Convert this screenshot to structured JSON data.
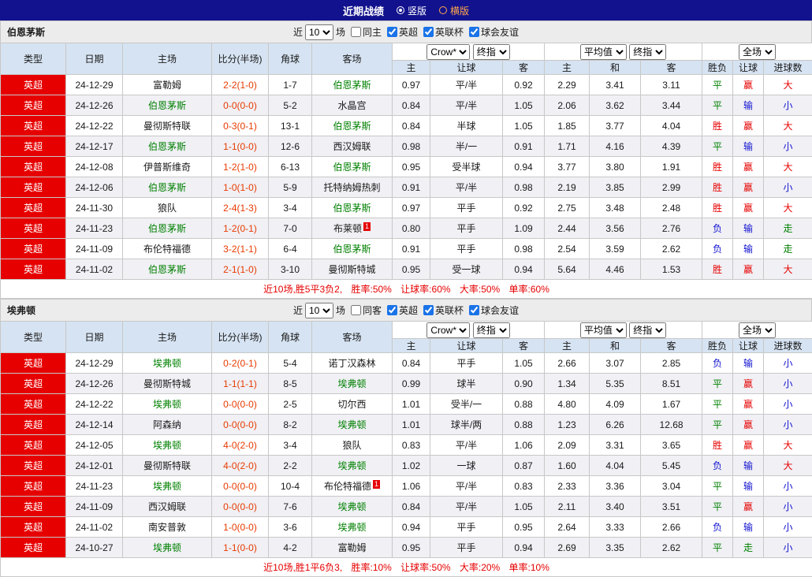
{
  "topbar": {
    "title": "近期战绩",
    "modes": [
      {
        "label": "竖版",
        "selected": true
      },
      {
        "label": "横版",
        "selected": false
      }
    ]
  },
  "columns": {
    "type": "类型",
    "date": "日期",
    "home": "主场",
    "score": "比分(半场)",
    "corner": "角球",
    "away": "客场",
    "bookmaker": "Crow*",
    "stage1": "终指",
    "average": "平均值",
    "stage2": "终指",
    "scope": "全场",
    "sub": [
      "主",
      "让球",
      "客",
      "主",
      "和",
      "客",
      "胜负",
      "让球",
      "进球数"
    ]
  },
  "colors": {
    "topbar_bg": "#12128e",
    "league_badge_bg": "#e60000",
    "focus_team": "#008000",
    "score_text": "#e83a00",
    "summary_text": "#e60000",
    "header_bg": "#d6e3f2",
    "alt_row_bg": "#f0f0f5",
    "mode_inactive": "#ffa64d",
    "result_text": {
      "胜": "#e60000",
      "赢": "#e60000",
      "大": "#e60000",
      "平": "#008000",
      "走": "#008000",
      "负": "#1212d0",
      "输": "#1212d0",
      "小": "#1212d0"
    }
  },
  "tables": [
    {
      "team": "伯恩茅斯",
      "filter": {
        "prefix": "近",
        "count": "10",
        "suffix": "场",
        "same": {
          "label": "同主",
          "checked": false
        },
        "leagues": [
          {
            "label": "英超",
            "checked": true
          },
          {
            "label": "英联杯",
            "checked": true
          },
          {
            "label": "球会友谊",
            "checked": true
          }
        ]
      },
      "rows": [
        {
          "type": "英超",
          "date": "24-12-29",
          "home": "富勒姆",
          "hf": false,
          "score": "2-2(1-0)",
          "corner": "1-7",
          "away": "伯恩茅斯",
          "af": true,
          "badge": "",
          "o": [
            "0.97",
            "平/半",
            "0.92"
          ],
          "avg": [
            "2.29",
            "3.41",
            "3.11"
          ],
          "res": [
            "平",
            "赢",
            "大"
          ]
        },
        {
          "type": "英超",
          "date": "24-12-26",
          "home": "伯恩茅斯",
          "hf": true,
          "score": "0-0(0-0)",
          "corner": "5-2",
          "away": "水晶宫",
          "af": false,
          "badge": "",
          "o": [
            "0.84",
            "平/半",
            "1.05"
          ],
          "avg": [
            "2.06",
            "3.62",
            "3.44"
          ],
          "res": [
            "平",
            "输",
            "小"
          ]
        },
        {
          "type": "英超",
          "date": "24-12-22",
          "home": "曼彻斯特联",
          "hf": false,
          "score": "0-3(0-1)",
          "corner": "13-1",
          "away": "伯恩茅斯",
          "af": true,
          "badge": "",
          "o": [
            "0.84",
            "半球",
            "1.05"
          ],
          "avg": [
            "1.85",
            "3.77",
            "4.04"
          ],
          "res": [
            "胜",
            "赢",
            "大"
          ]
        },
        {
          "type": "英超",
          "date": "24-12-17",
          "home": "伯恩茅斯",
          "hf": true,
          "score": "1-1(0-0)",
          "corner": "12-6",
          "away": "西汉姆联",
          "af": false,
          "badge": "",
          "o": [
            "0.98",
            "半/一",
            "0.91"
          ],
          "avg": [
            "1.71",
            "4.16",
            "4.39"
          ],
          "res": [
            "平",
            "输",
            "小"
          ]
        },
        {
          "type": "英超",
          "date": "24-12-08",
          "home": "伊普斯维奇",
          "hf": false,
          "score": "1-2(1-0)",
          "corner": "6-13",
          "away": "伯恩茅斯",
          "af": true,
          "badge": "",
          "o": [
            "0.95",
            "受半球",
            "0.94"
          ],
          "avg": [
            "3.77",
            "3.80",
            "1.91"
          ],
          "res": [
            "胜",
            "赢",
            "大"
          ]
        },
        {
          "type": "英超",
          "date": "24-12-06",
          "home": "伯恩茅斯",
          "hf": true,
          "score": "1-0(1-0)",
          "corner": "5-9",
          "away": "托特纳姆热刺",
          "af": false,
          "badge": "",
          "o": [
            "0.91",
            "平/半",
            "0.98"
          ],
          "avg": [
            "2.19",
            "3.85",
            "2.99"
          ],
          "res": [
            "胜",
            "赢",
            "小"
          ]
        },
        {
          "type": "英超",
          "date": "24-11-30",
          "home": "狼队",
          "hf": false,
          "score": "2-4(1-3)",
          "corner": "3-4",
          "away": "伯恩茅斯",
          "af": true,
          "badge": "",
          "o": [
            "0.97",
            "平手",
            "0.92"
          ],
          "avg": [
            "2.75",
            "3.48",
            "2.48"
          ],
          "res": [
            "胜",
            "赢",
            "大"
          ]
        },
        {
          "type": "英超",
          "date": "24-11-23",
          "home": "伯恩茅斯",
          "hf": true,
          "score": "1-2(0-1)",
          "corner": "7-0",
          "away": "布莱顿",
          "af": false,
          "badge": "1",
          "o": [
            "0.80",
            "平手",
            "1.09"
          ],
          "avg": [
            "2.44",
            "3.56",
            "2.76"
          ],
          "res": [
            "负",
            "输",
            "走"
          ]
        },
        {
          "type": "英超",
          "date": "24-11-09",
          "home": "布伦特福德",
          "hf": false,
          "score": "3-2(1-1)",
          "corner": "6-4",
          "away": "伯恩茅斯",
          "af": true,
          "badge": "",
          "o": [
            "0.91",
            "平手",
            "0.98"
          ],
          "avg": [
            "2.54",
            "3.59",
            "2.62"
          ],
          "res": [
            "负",
            "输",
            "走"
          ]
        },
        {
          "type": "英超",
          "date": "24-11-02",
          "home": "伯恩茅斯",
          "hf": true,
          "score": "2-1(1-0)",
          "corner": "3-10",
          "away": "曼彻斯特城",
          "af": false,
          "badge": "",
          "o": [
            "0.95",
            "受一球",
            "0.94"
          ],
          "avg": [
            "5.64",
            "4.46",
            "1.53"
          ],
          "res": [
            "胜",
            "赢",
            "大"
          ]
        }
      ],
      "summary": "近10场,胜5平3负2, 胜率:50% 让球率:60% 大率:50% 单率:60%"
    },
    {
      "team": "埃弗顿",
      "filter": {
        "prefix": "近",
        "count": "10",
        "suffix": "场",
        "same": {
          "label": "同客",
          "checked": false
        },
        "leagues": [
          {
            "label": "英超",
            "checked": true
          },
          {
            "label": "英联杯",
            "checked": true
          },
          {
            "label": "球会友谊",
            "checked": true
          }
        ]
      },
      "rows": [
        {
          "type": "英超",
          "date": "24-12-29",
          "home": "埃弗顿",
          "hf": true,
          "score": "0-2(0-1)",
          "corner": "5-4",
          "away": "诺丁汉森林",
          "af": false,
          "badge": "",
          "o": [
            "0.84",
            "平手",
            "1.05"
          ],
          "avg": [
            "2.66",
            "3.07",
            "2.85"
          ],
          "res": [
            "负",
            "输",
            "小"
          ]
        },
        {
          "type": "英超",
          "date": "24-12-26",
          "home": "曼彻斯特城",
          "hf": false,
          "score": "1-1(1-1)",
          "corner": "8-5",
          "away": "埃弗顿",
          "af": true,
          "badge": "",
          "o": [
            "0.99",
            "球半",
            "0.90"
          ],
          "avg": [
            "1.34",
            "5.35",
            "8.51"
          ],
          "res": [
            "平",
            "赢",
            "小"
          ]
        },
        {
          "type": "英超",
          "date": "24-12-22",
          "home": "埃弗顿",
          "hf": true,
          "score": "0-0(0-0)",
          "corner": "2-5",
          "away": "切尔西",
          "af": false,
          "badge": "",
          "o": [
            "1.01",
            "受半/一",
            "0.88"
          ],
          "avg": [
            "4.80",
            "4.09",
            "1.67"
          ],
          "res": [
            "平",
            "赢",
            "小"
          ]
        },
        {
          "type": "英超",
          "date": "24-12-14",
          "home": "阿森纳",
          "hf": false,
          "score": "0-0(0-0)",
          "corner": "8-2",
          "away": "埃弗顿",
          "af": true,
          "badge": "",
          "o": [
            "1.01",
            "球半/两",
            "0.88"
          ],
          "avg": [
            "1.23",
            "6.26",
            "12.68"
          ],
          "res": [
            "平",
            "赢",
            "小"
          ]
        },
        {
          "type": "英超",
          "date": "24-12-05",
          "home": "埃弗顿",
          "hf": true,
          "score": "4-0(2-0)",
          "corner": "3-4",
          "away": "狼队",
          "af": false,
          "badge": "",
          "o": [
            "0.83",
            "平/半",
            "1.06"
          ],
          "avg": [
            "2.09",
            "3.31",
            "3.65"
          ],
          "res": [
            "胜",
            "赢",
            "大"
          ]
        },
        {
          "type": "英超",
          "date": "24-12-01",
          "home": "曼彻斯特联",
          "hf": false,
          "score": "4-0(2-0)",
          "corner": "2-2",
          "away": "埃弗顿",
          "af": true,
          "badge": "",
          "o": [
            "1.02",
            "一球",
            "0.87"
          ],
          "avg": [
            "1.60",
            "4.04",
            "5.45"
          ],
          "res": [
            "负",
            "输",
            "大"
          ]
        },
        {
          "type": "英超",
          "date": "24-11-23",
          "home": "埃弗顿",
          "hf": true,
          "score": "0-0(0-0)",
          "corner": "10-4",
          "away": "布伦特福德",
          "af": false,
          "badge": "1",
          "o": [
            "1.06",
            "平/半",
            "0.83"
          ],
          "avg": [
            "2.33",
            "3.36",
            "3.04"
          ],
          "res": [
            "平",
            "输",
            "小"
          ]
        },
        {
          "type": "英超",
          "date": "24-11-09",
          "home": "西汉姆联",
          "hf": false,
          "score": "0-0(0-0)",
          "corner": "7-6",
          "away": "埃弗顿",
          "af": true,
          "badge": "",
          "o": [
            "0.84",
            "平/半",
            "1.05"
          ],
          "avg": [
            "2.11",
            "3.40",
            "3.51"
          ],
          "res": [
            "平",
            "赢",
            "小"
          ]
        },
        {
          "type": "英超",
          "date": "24-11-02",
          "home": "南安普敦",
          "hf": false,
          "score": "1-0(0-0)",
          "corner": "3-6",
          "away": "埃弗顿",
          "af": true,
          "badge": "",
          "o": [
            "0.94",
            "平手",
            "0.95"
          ],
          "avg": [
            "2.64",
            "3.33",
            "2.66"
          ],
          "res": [
            "负",
            "输",
            "小"
          ]
        },
        {
          "type": "英超",
          "date": "24-10-27",
          "home": "埃弗顿",
          "hf": true,
          "score": "1-1(0-0)",
          "corner": "4-2",
          "away": "富勒姆",
          "af": false,
          "badge": "",
          "o": [
            "0.95",
            "平手",
            "0.94"
          ],
          "avg": [
            "2.69",
            "3.35",
            "2.62"
          ],
          "res": [
            "平",
            "走",
            "小"
          ]
        }
      ],
      "summary": "近10场,胜1平6负3, 胜率:10% 让球率:50% 大率:20% 单率:10%"
    }
  ]
}
